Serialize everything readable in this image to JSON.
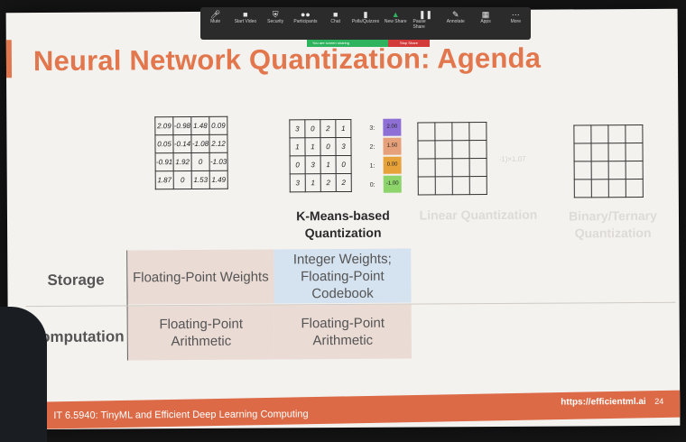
{
  "zoom_toolbar": {
    "items": [
      {
        "label": "Mute",
        "icon": "microphone-icon"
      },
      {
        "label": "Start Video",
        "icon": "video-camera-icon"
      },
      {
        "label": "Security",
        "icon": "shield-icon"
      },
      {
        "label": "Participants",
        "icon": "people-icon"
      },
      {
        "label": "Chat",
        "icon": "chat-icon"
      },
      {
        "label": "Polls/Quizzes",
        "icon": "bar-chart-icon"
      },
      {
        "label": "New Share",
        "icon": "share-screen-icon"
      },
      {
        "label": "Pause Share",
        "icon": "pause-icon"
      },
      {
        "label": "Annotate",
        "icon": "pencil-icon"
      },
      {
        "label": "Apps",
        "icon": "apps-icon"
      },
      {
        "label": "More",
        "icon": "more-icon"
      }
    ],
    "sharing_notice": "You are screen sharing",
    "stop_share": "Stop Share"
  },
  "slide": {
    "title": "Neural Network Quantization: Agenda",
    "weights_matrix": [
      [
        "2.09",
        "-0.98",
        "1.48",
        "0.09"
      ],
      [
        "0.05",
        "-0.14",
        "-1.08",
        "2.12"
      ],
      [
        "-0.91",
        "1.92",
        "0",
        "-1.03"
      ],
      [
        "1.87",
        "0",
        "1.53",
        "1.49"
      ]
    ],
    "index_matrix": [
      [
        "3",
        "0",
        "2",
        "1"
      ],
      [
        "1",
        "1",
        "0",
        "3"
      ],
      [
        "0",
        "3",
        "1",
        "0"
      ],
      [
        "3",
        "1",
        "2",
        "2"
      ]
    ],
    "codebook": [
      {
        "index": "3:",
        "value": "2.00",
        "color": "#8e6fd6"
      },
      {
        "index": "2:",
        "value": "1.50",
        "color": "#e6a17a"
      },
      {
        "index": "1:",
        "value": "0.00",
        "color": "#e8a23a"
      },
      {
        "index": "0:",
        "value": "-1.00",
        "color": "#8dd46b"
      }
    ],
    "linear_fragment": "-1)×1.07",
    "methods": [
      {
        "label": "K-Means-based Quantization"
      },
      {
        "label": "Linear Quantization"
      },
      {
        "label": "Binary/Ternary Quantization"
      }
    ],
    "table": {
      "rows": [
        {
          "label": "Storage",
          "floating": "Floating-Point Weights",
          "kmeans": "Integer Weights; Floating-Point Codebook"
        },
        {
          "label": "Computation",
          "floating": "Floating-Point Arithmetic",
          "kmeans": "Floating-Point Arithmetic"
        }
      ],
      "colors": {
        "floating": "#eadbd4",
        "kmeans_storage": "#d5e2ef",
        "kmeans_computation": "#eadbd4"
      }
    },
    "footer": {
      "course": "IT 6.5940: TinyML and Efficient Deep Learning Computing",
      "url": "https://efficientml.ai",
      "page": "24"
    },
    "accent_color": "#e2774e"
  }
}
